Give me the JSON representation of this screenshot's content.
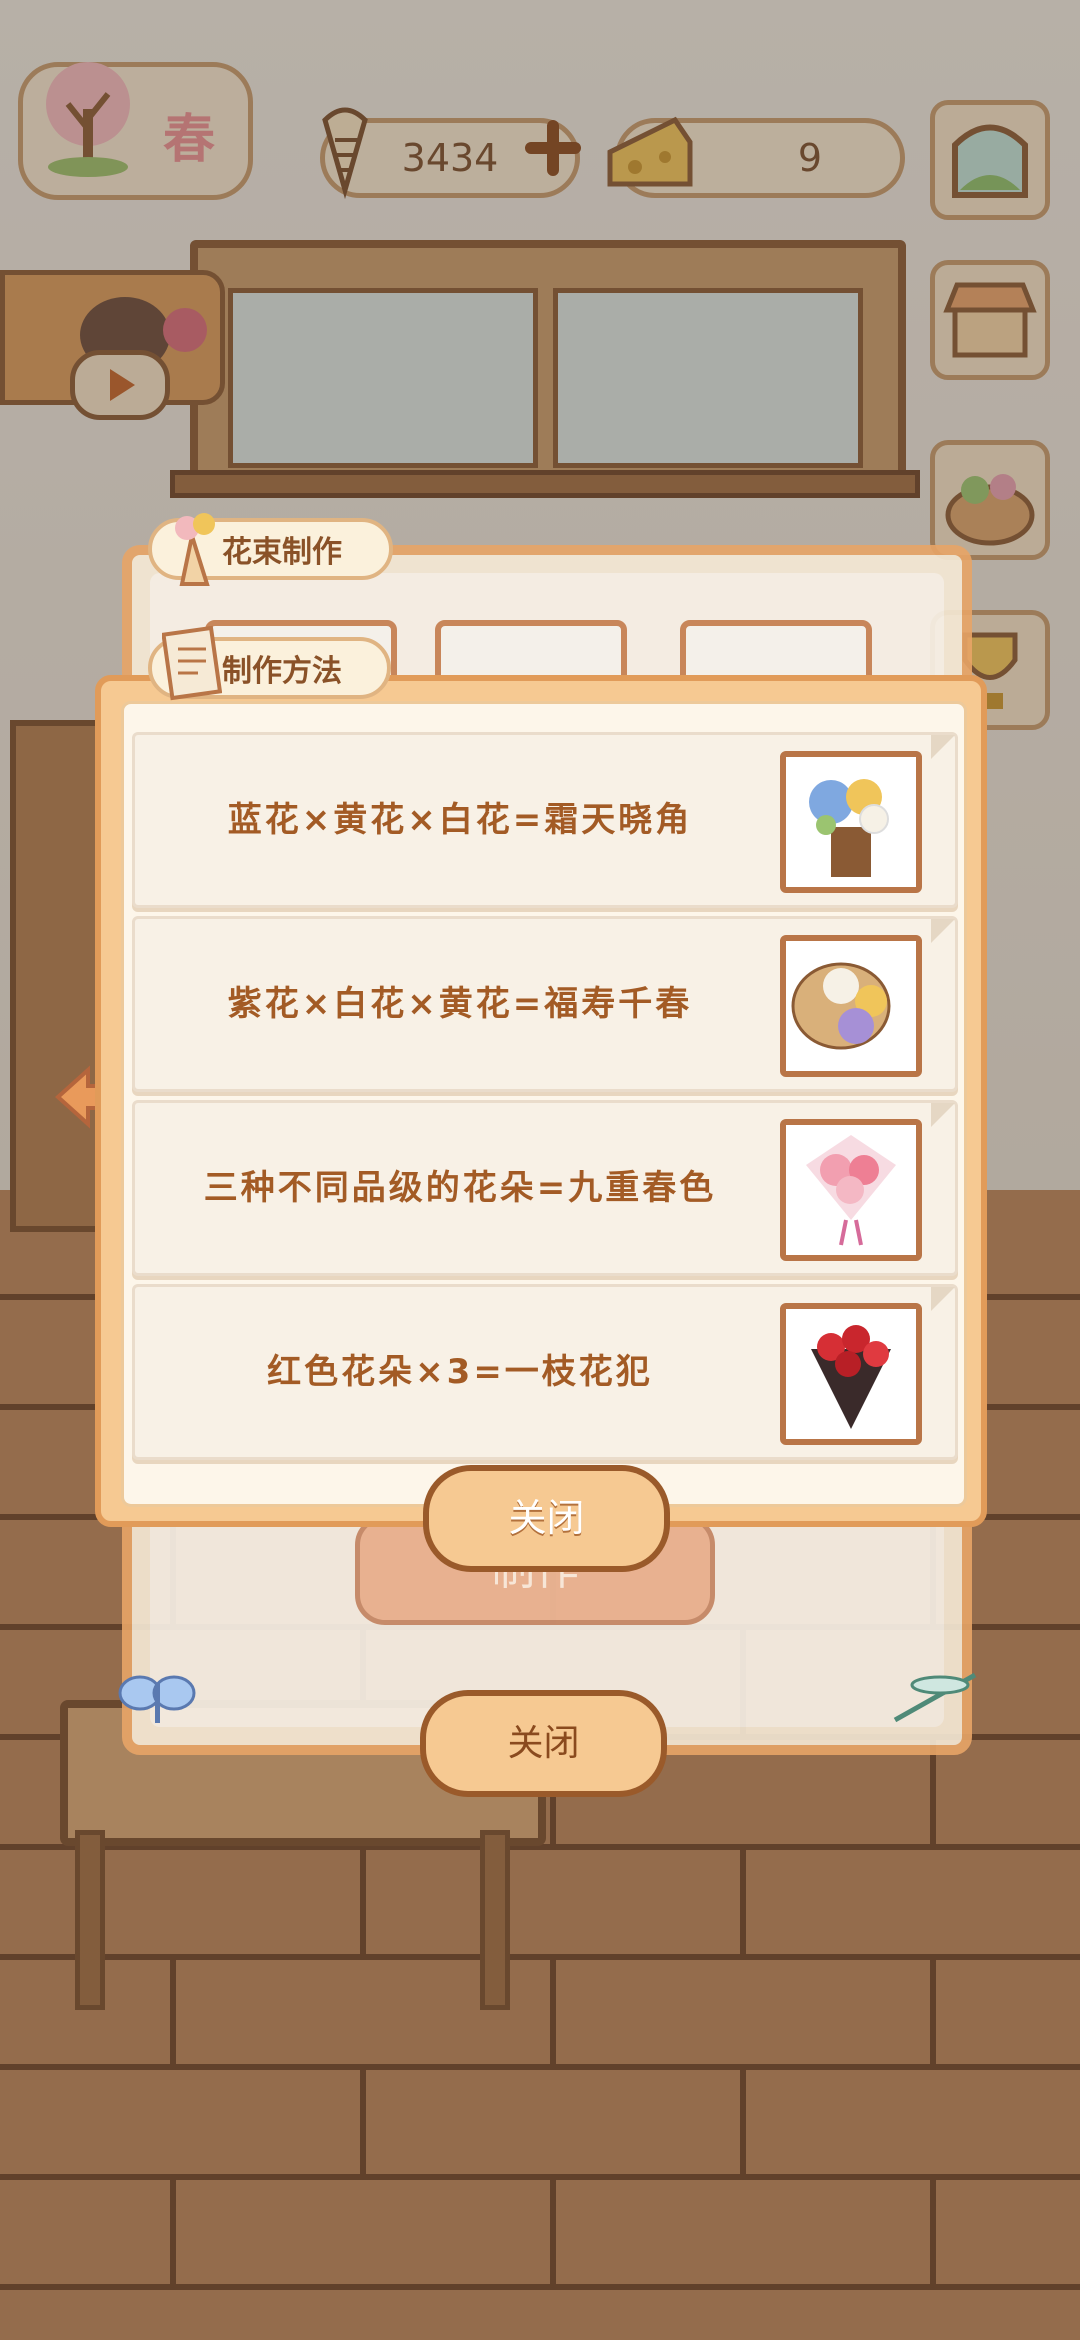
{
  "hud": {
    "season": "春",
    "fish_count": "3434",
    "cheese_count": "9"
  },
  "back_panel": {
    "title": "花束制作",
    "make_button": "制作",
    "close_button": "关闭"
  },
  "recipe_panel": {
    "title": "制作方法",
    "recipes": [
      {
        "formula": "蓝花×黄花×白花=霜天晓角",
        "icon": "blue-yellow-bouquet-icon"
      },
      {
        "formula": "紫花×白花×黄花=福寿千春",
        "icon": "basket-bouquet-icon"
      },
      {
        "formula": "三种不同品级的花朵=九重春色",
        "icon": "pink-bouquet-icon"
      },
      {
        "formula": "红色花朵×3=一枝花犯",
        "icon": "red-rose-bouquet-icon"
      }
    ],
    "close_button": "关闭"
  },
  "colors": {
    "panel_border": "#e19b59",
    "recipe_text": "#a35b25",
    "button_fill": "#f6c992"
  }
}
